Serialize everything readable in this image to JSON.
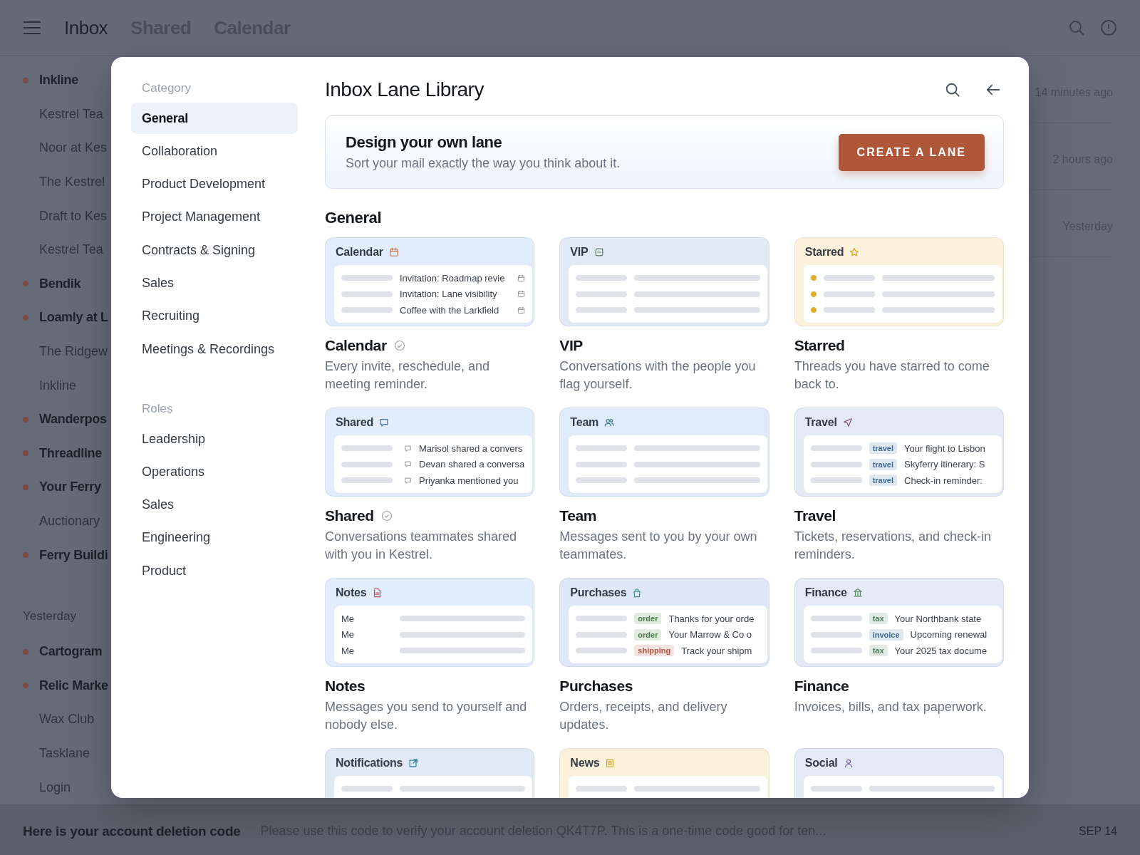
{
  "top_bar": {
    "tabs": [
      {
        "label": "Inbox",
        "selected": true
      },
      {
        "label": "Shared",
        "selected": false
      },
      {
        "label": "Calendar",
        "selected": false
      }
    ]
  },
  "mail_list": [
    {
      "kind": "mail",
      "label": "Inkline",
      "unread": true
    },
    {
      "kind": "mail",
      "label": "Kestrel Tea",
      "unread": false
    },
    {
      "kind": "mail",
      "label": "Noor at Kes",
      "unread": false
    },
    {
      "kind": "mail",
      "label": "The Kestrel",
      "unread": false
    },
    {
      "kind": "mail",
      "label": "Draft to Kes",
      "unread": false
    },
    {
      "kind": "mail",
      "label": "Kestrel Tea",
      "unread": false
    },
    {
      "kind": "mail",
      "label": "Bendik",
      "unread": true
    },
    {
      "kind": "mail",
      "label": "Loamly at L",
      "unread": true
    },
    {
      "kind": "mail",
      "label": "The Ridgew",
      "unread": false
    },
    {
      "kind": "mail",
      "label": "Inkline",
      "unread": false
    },
    {
      "kind": "mail",
      "label": "Wanderpos",
      "unread": true
    },
    {
      "kind": "mail",
      "label": "Threadline",
      "unread": true
    },
    {
      "kind": "mail",
      "label": "Your Ferry",
      "unread": true
    },
    {
      "kind": "mail",
      "label": "Auctionary",
      "unread": false
    },
    {
      "kind": "mail",
      "label": "Ferry Buildi",
      "unread": true
    },
    {
      "kind": "section",
      "label": "Yesterday"
    },
    {
      "kind": "mail",
      "label": "Cartogram",
      "unread": true
    },
    {
      "kind": "mail",
      "label": "Relic Marke",
      "unread": true
    },
    {
      "kind": "mail",
      "label": "Wax Club",
      "unread": false
    },
    {
      "kind": "mail",
      "label": "Tasklane",
      "unread": false
    },
    {
      "kind": "mail",
      "label": "Login",
      "unread": false
    }
  ],
  "times": [
    "14 minutes ago",
    "2 hours ago",
    "Yesterday"
  ],
  "bottom_message": {
    "subject": "Here is your account deletion code",
    "preview": "Please use this code to verify your account deletion QK4T7P. This is a one-time code good for ten...",
    "date": "SEP 14"
  },
  "modal": {
    "title": "Inbox Lane Library",
    "sidebar": [
      {
        "heading": "Category",
        "items": [
          {
            "label": "General",
            "selected": true
          },
          {
            "label": "Collaboration",
            "selected": false
          },
          {
            "label": "Product Development",
            "selected": false
          },
          {
            "label": "Project Management",
            "selected": false
          },
          {
            "label": "Contracts & Signing",
            "selected": false
          },
          {
            "label": "Sales",
            "selected": false
          },
          {
            "label": "Recruiting",
            "selected": false
          },
          {
            "label": "Meetings & Recordings",
            "selected": false
          }
        ]
      },
      {
        "heading": "Roles",
        "items": [
          {
            "label": "Leadership",
            "selected": false
          },
          {
            "label": "Operations",
            "selected": false
          },
          {
            "label": "Sales",
            "selected": false
          },
          {
            "label": "Engineering",
            "selected": false
          },
          {
            "label": "Product",
            "selected": false
          }
        ]
      }
    ],
    "banner": {
      "title": "Design your own lane",
      "subtitle": "Sort your mail exactly the way you think about it.",
      "button": "CREATE A LANE"
    },
    "section_title": "General",
    "cards": [
      {
        "label": "Calendar",
        "color": "#e1edfc",
        "added": true,
        "preview": {
          "kind": "events",
          "rows": [
            "Invitation: Roadmap revie",
            "Invitation: Lane visibility",
            "Coffee with the Larkfield"
          ]
        },
        "title": "Calendar",
        "description": "Every invite, reschedule, and meeting reminder."
      },
      {
        "label": "VIP",
        "color": "#e1e9f5",
        "added": false,
        "preview": {
          "kind": "blank"
        },
        "title": "VIP",
        "description": "Conversations with the people you flag yourself."
      },
      {
        "label": "Starred",
        "color": "#fcf1da",
        "added": false,
        "preview": {
          "kind": "starred"
        },
        "title": "Starred",
        "description": "Threads you have starred to come back to."
      },
      {
        "label": "Shared",
        "color": "#e1edfc",
        "added": true,
        "preview": {
          "kind": "shares",
          "rows": [
            "Marisol shared a convers",
            "Devan shared a conversa",
            "Priyanka mentioned you"
          ]
        },
        "title": "Shared",
        "description": "Conversations teammates shared with you in Kestrel."
      },
      {
        "label": "Team",
        "color": "#dfeafb",
        "added": false,
        "preview": {
          "kind": "blank"
        },
        "title": "Team",
        "description": "Messages sent to you by your own teammates."
      },
      {
        "label": "Travel",
        "color": "#e3e9f5",
        "added": false,
        "preview": {
          "kind": "tagged",
          "rows": [
            {
              "tag": "travel",
              "color": "#3d6a9a",
              "text": "Your flight to Lisbon"
            },
            {
              "tag": "travel",
              "color": "#3d6a9a",
              "text": "Skyferry itinerary: S"
            },
            {
              "tag": "travel",
              "color": "#3d6a9a",
              "text": "Check-in reminder:"
            }
          ]
        },
        "title": "Travel",
        "description": "Tickets, reservations, and check-in reminders."
      },
      {
        "label": "Notes",
        "color": "#e1edfc",
        "added": false,
        "preview": {
          "kind": "notes",
          "rows": [
            "Me",
            "Me",
            "Me"
          ]
        },
        "title": "Notes",
        "description": "Messages you send to yourself and nobody else."
      },
      {
        "label": "Purchases",
        "color": "#dfe8f6",
        "added": false,
        "preview": {
          "kind": "tagged",
          "rows": [
            {
              "tag": "order",
              "color": "#4a7a4a",
              "text": "Thanks for your orde"
            },
            {
              "tag": "order",
              "color": "#4a7a4a",
              "text": "Your Marrow & Co o"
            },
            {
              "tag": "shipping",
              "color": "#b4533e",
              "text": "Track your shipm"
            }
          ]
        },
        "title": "Purchases",
        "description": "Orders, receipts, and delivery updates."
      },
      {
        "label": "Finance",
        "color": "#e3e9f5",
        "added": false,
        "preview": {
          "kind": "tagged",
          "rows": [
            {
              "tag": "tax",
              "color": "#4b7a5b",
              "text": "Your Northbank state"
            },
            {
              "tag": "invoice",
              "color": "#3d6a9a",
              "text": "Upcoming renewal"
            },
            {
              "tag": "tax",
              "color": "#4b7a5b",
              "text": "Your 2025 tax docume"
            }
          ]
        },
        "title": "Finance",
        "description": "Invoices, bills, and tax paperwork."
      },
      {
        "label": "Notifications",
        "color": "#e1e9f5",
        "preview": {
          "kind": "blank"
        }
      },
      {
        "label": "News",
        "color": "#fcf1da",
        "preview": {
          "kind": "blank"
        }
      },
      {
        "label": "Social",
        "color": "#e3e9f5",
        "preview": {
          "kind": "blank"
        }
      }
    ]
  }
}
